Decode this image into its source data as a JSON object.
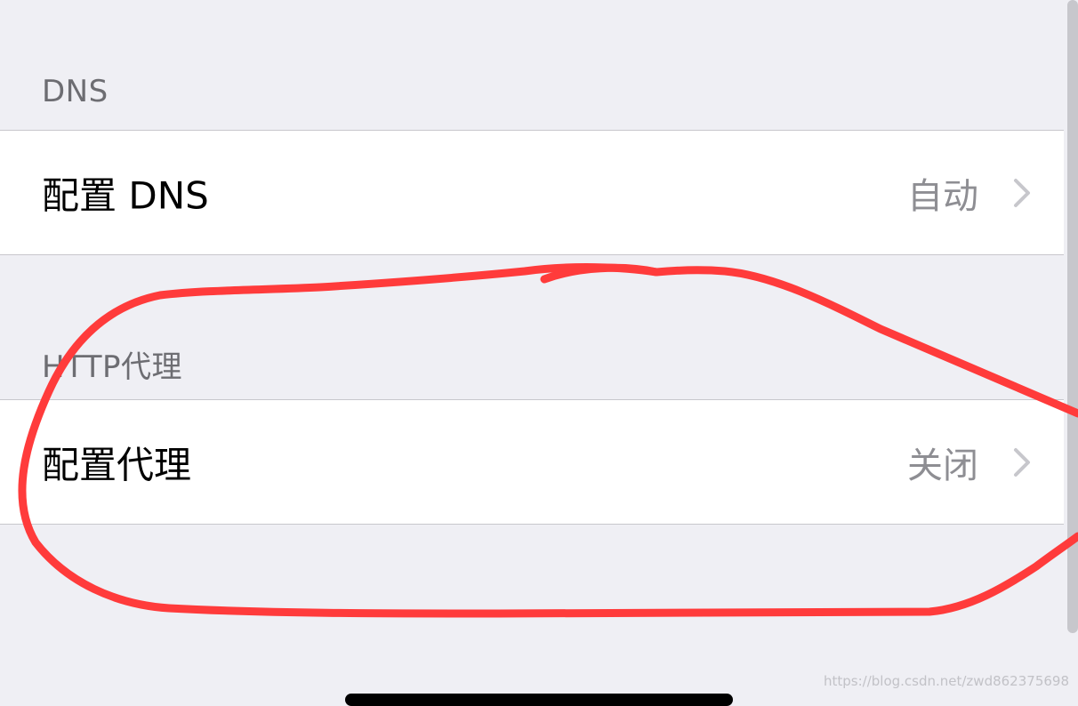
{
  "sections": [
    {
      "header": "DNS",
      "row": {
        "label": "配置 DNS",
        "value": "自动",
        "icon": "chevron-right-icon"
      }
    },
    {
      "header": "HTTP代理",
      "row": {
        "label": "配置代理",
        "value": "关闭",
        "icon": "chevron-right-icon"
      }
    }
  ],
  "watermark": "https://blog.csdn.net/zwd862375698",
  "colors": {
    "background": "#efeff4",
    "cell": "#ffffff",
    "separator": "#c8c7cc",
    "header_text": "#6d6d72",
    "value_text": "#8e8e93",
    "annotation": "#ff3b3b"
  }
}
